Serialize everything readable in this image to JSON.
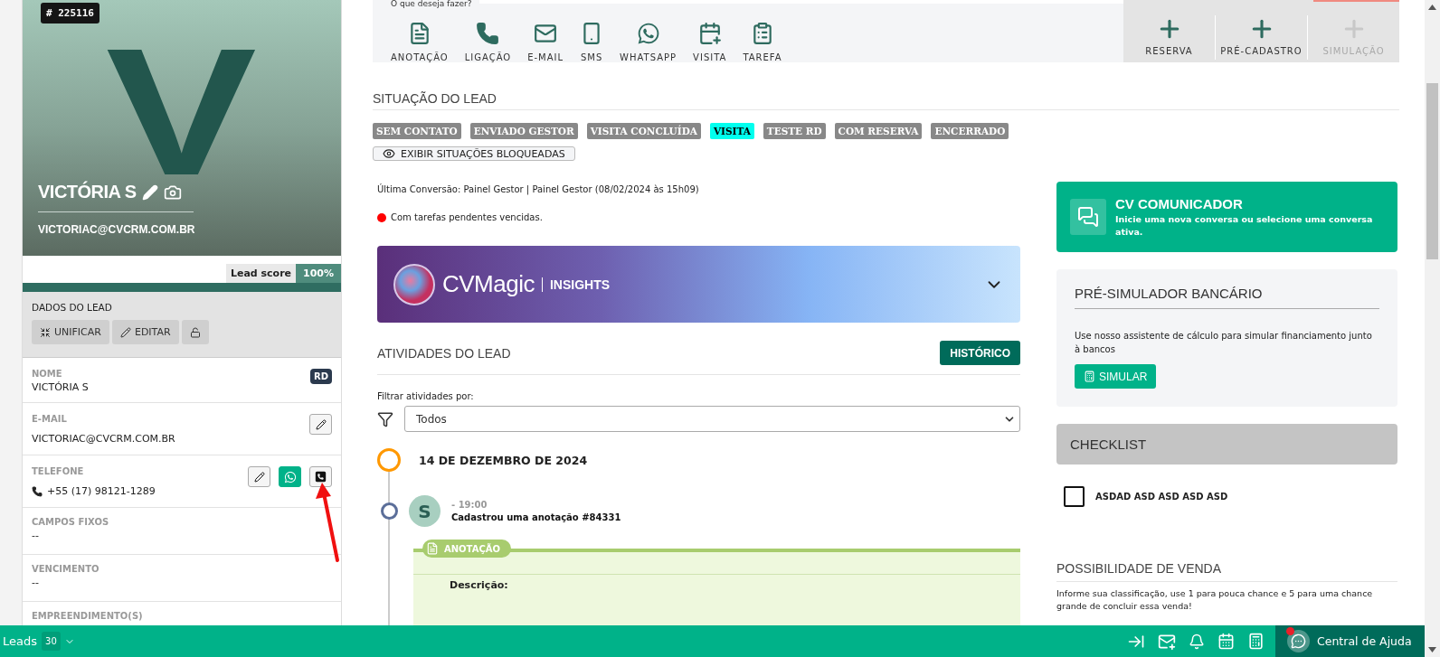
{
  "lead_card": {
    "id_badge": "# 225116",
    "initial": "V",
    "name": "VICTÓRIA S",
    "email": "VICTORIAC@CVCRM.COM.BR",
    "lead_score_label": "Lead score",
    "lead_score_value": "100%",
    "section_title": "DADOS DO LEAD",
    "buttons": [
      {
        "kind": "merge",
        "label": "UNIFICAR"
      },
      {
        "kind": "edit",
        "label": "EDITAR"
      },
      {
        "kind": "lock"
      }
    ]
  },
  "fields": [
    {
      "kind": "text",
      "label": "NOME",
      "value": "VICTÓRIA S",
      "badge": "RD"
    },
    {
      "kind": "text",
      "label": "E-MAIL",
      "value": "VICTORIAC@CVCRM.COM.BR",
      "actions": [
        {
          "kind": "edit"
        }
      ]
    },
    {
      "kind": "phone",
      "label": "TELEFONE",
      "value": "+55 (17) 98121-1289",
      "actions": [
        {
          "kind": "edit"
        },
        {
          "kind": "whatsapp"
        },
        {
          "kind": "call"
        }
      ]
    },
    {
      "kind": "text",
      "label": "CAMPOS FIXOS",
      "value": "--"
    },
    {
      "kind": "text",
      "label": "VENCIMENTO",
      "value": "--"
    },
    {
      "kind": "text",
      "label": "EMPREENDIMENTO(S)"
    }
  ],
  "quick_actions": {
    "prompt": "O que deseja fazer?",
    "items": [
      {
        "kind": "note",
        "label": "ANOTAÇÃO"
      },
      {
        "kind": "call",
        "label": "LIGAÇÃO"
      },
      {
        "kind": "email",
        "label": "E-MAIL"
      },
      {
        "kind": "sms",
        "label": "SMS"
      },
      {
        "kind": "whatsapp",
        "label": "WHATSAPP"
      },
      {
        "kind": "visit",
        "label": "VISITA"
      },
      {
        "kind": "task",
        "label": "TAREFA"
      }
    ],
    "create": [
      {
        "label": "RESERVA",
        "disabled": false
      },
      {
        "label": "PRÉ-CADASTRO",
        "disabled": false
      },
      {
        "label": "SIMULAÇÃO",
        "disabled": true
      }
    ]
  },
  "status": {
    "title": "SITUAÇÃO DO LEAD",
    "tags": [
      {
        "label": "SEM CONTATO",
        "selected": false
      },
      {
        "label": "ENVIADO GESTOR",
        "selected": false
      },
      {
        "label": "VISITA CONCLUÍDA",
        "selected": false
      },
      {
        "label": "VISITA",
        "selected": true
      },
      {
        "label": "TESTE RD",
        "selected": false
      },
      {
        "label": "COM RESERVA",
        "selected": false
      },
      {
        "label": "ENCERRADO",
        "selected": false
      }
    ],
    "blocked_button": "EXIBIR SITUAÇÕES BLOQUEADAS"
  },
  "last_conversion": "Última Conversão: Painel Gestor | Painel Gestor (08/02/2024 às 15h09)",
  "alert": "Com tarefas pendentes vencidas.",
  "insights_banner": {
    "brand": "CVMagic",
    "label": "INSIGHTS",
    "expanded": false
  },
  "activities": {
    "title": "ATIVIDADES DO LEAD",
    "history_button": "HISTÓRICO",
    "filter_label": "Filtrar atividades por:",
    "filter_value": "Todos",
    "groups": [
      {
        "date": "14 DE DEZEMBRO DE 2024",
        "entries": [
          {
            "avatar": "S",
            "time": "- 19:00",
            "text": "Cadastrou uma anotação #84331",
            "type_label": "ANOTAÇÃO",
            "rows": [
              "Descrição:"
            ]
          }
        ]
      }
    ]
  },
  "communicator": {
    "title": "CV COMUNICADOR",
    "text": "Inicie uma nova conversa ou selecione uma conversa ativa."
  },
  "pre_simulator": {
    "title": "PRÉ-SIMULADOR BANCÁRIO",
    "text": "Use nosso assistente de cálculo para simular financiamento junto à bancos",
    "button": "SIMULAR"
  },
  "checklist": {
    "title": "CHECKLIST",
    "items": [
      {
        "label": "ASDAD ASD ASD ASD ASD",
        "checked": false
      }
    ]
  },
  "sale_chance": {
    "title": "POSSIBILIDADE DE VENDA",
    "text": "Informe sua classificação, use 1 para pouca chance e 5 para uma chance grande de concluir essa venda!"
  },
  "bottom_bar": {
    "module": "Leads",
    "count": "30",
    "help": "Central de Ajuda",
    "help_notification": true
  }
}
